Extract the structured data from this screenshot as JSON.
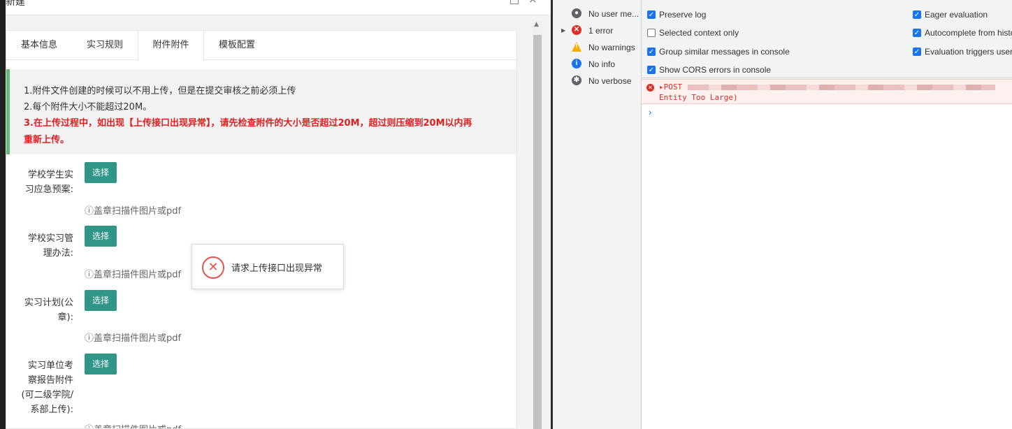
{
  "modal": {
    "title": "新建",
    "max_glyph": "□",
    "close_glyph": "×",
    "tabs": [
      {
        "label": "基本信息"
      },
      {
        "label": "实习规则"
      },
      {
        "label": "附件附件",
        "active": true
      },
      {
        "label": "模板配置"
      }
    ],
    "notice": {
      "line1": "1.附件文件创建的时候可以不用上传，但是在提交审核之前必须上传",
      "line2": "2.每个附件大小不能超过20M。",
      "line3a": "3.在上传过程中，如出现【上传接口出现异常】，请先检查附件的大小是否超过20M，超过则压缩到20M以内再",
      "line3b": "重新上传。"
    },
    "fields": [
      {
        "label_l1": "学校学生实",
        "label_l2": "习应急预案:",
        "button": "选择",
        "hint": "ⓘ盖章扫描件图片或pdf"
      },
      {
        "label_l1": "学校实习管",
        "label_l2": "理办法:",
        "button": "选择",
        "hint": "ⓘ盖章扫描件图片或pdf"
      },
      {
        "label_l1": "实习计划(公",
        "label_l2": "章):",
        "button": "选择",
        "hint": "ⓘ盖章扫描件图片或pdf"
      },
      {
        "label_l1": "实习单位考",
        "label_l2": "察报告附件",
        "label_l3": "(可二级学院/",
        "label_l4": "系部上传):",
        "button": "选择",
        "hint": "ⓘ盖章扫描件图片或pdf"
      }
    ],
    "toast": {
      "icon": "close-circle-icon",
      "glyph": "✕",
      "text": "请求上传接口出现异常"
    }
  },
  "devtools": {
    "sidebar": [
      {
        "label": "No user me...",
        "icon": "user-icon",
        "color": "#5f6368"
      },
      {
        "label": "1 error",
        "icon": "error-icon",
        "color": "#d93025",
        "expandable": true
      },
      {
        "label": "No warnings",
        "icon": "warning-icon",
        "color": "#f9ab00"
      },
      {
        "label": "No info",
        "icon": "info-icon",
        "color": "#1a73e8"
      },
      {
        "label": "No verbose",
        "icon": "bug-icon",
        "color": "#5f6368"
      }
    ],
    "settings_left": [
      {
        "label": "Preserve log",
        "checked": true
      },
      {
        "label": "Selected context only",
        "checked": false
      },
      {
        "label": "Group similar messages in console",
        "checked": true
      },
      {
        "label": "Show CORS errors in console",
        "checked": true
      }
    ],
    "settings_right": [
      {
        "label": "Eager evaluation",
        "checked": true
      },
      {
        "label": "Autocomplete from history",
        "checked": true
      },
      {
        "label": "Evaluation triggers user activation",
        "checked": true
      }
    ],
    "error": {
      "line1": "▸POST",
      "line2": "Entity Too Large)"
    },
    "prompt": "›"
  }
}
